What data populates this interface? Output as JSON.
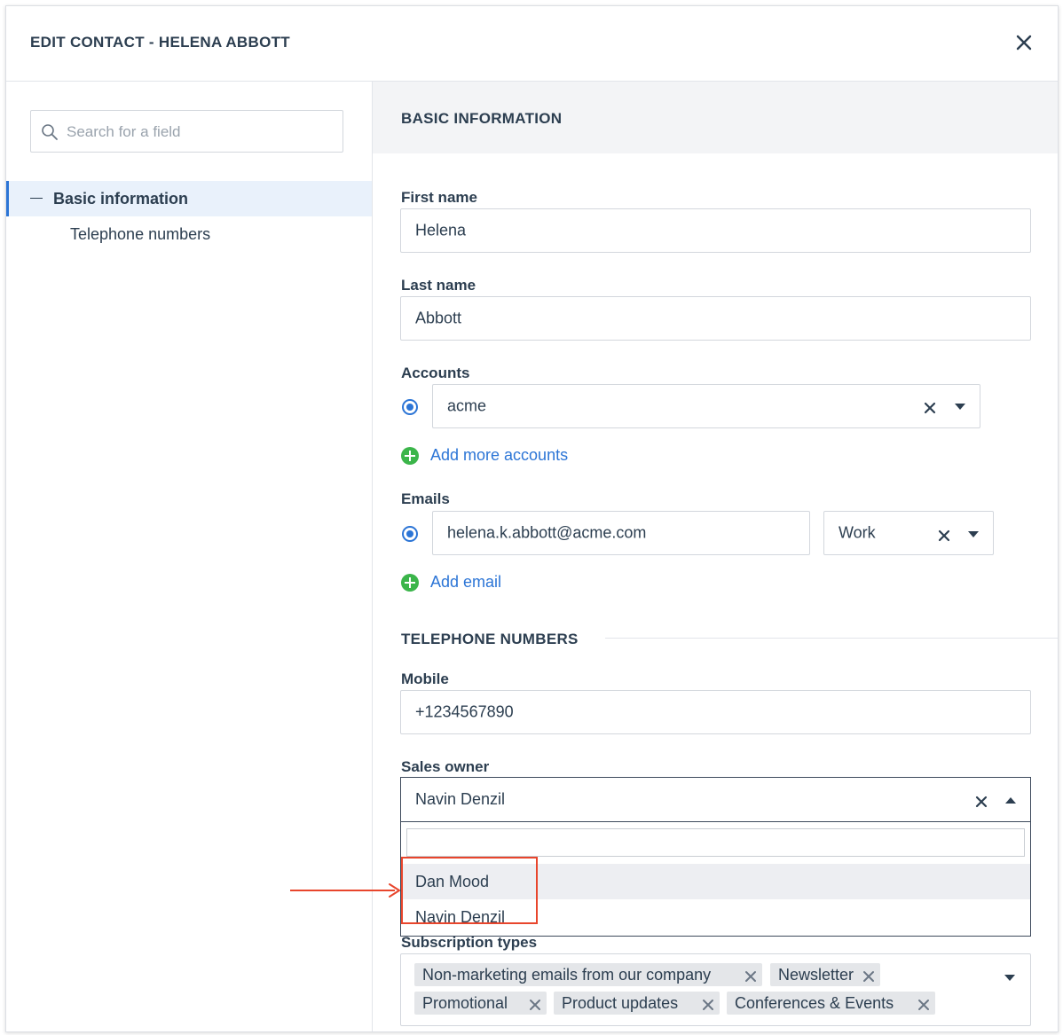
{
  "modal": {
    "title": "EDIT CONTACT - HELENA ABBOTT"
  },
  "sidebar": {
    "search_placeholder": "Search for a field",
    "items": [
      {
        "label": "Basic information",
        "active": true
      },
      {
        "label": "Telephone numbers",
        "active": false
      }
    ]
  },
  "main": {
    "section_title": "BASIC INFORMATION",
    "first_name": {
      "label": "First name",
      "value": "Helena"
    },
    "last_name": {
      "label": "Last name",
      "value": "Abbott"
    },
    "accounts": {
      "label": "Accounts",
      "value": "acme",
      "add_label": "Add more accounts"
    },
    "emails": {
      "label": "Emails",
      "value": "helena.k.abbott@acme.com",
      "type": "Work",
      "add_label": "Add email"
    },
    "telephone_section_title": "TELEPHONE NUMBERS",
    "mobile": {
      "label": "Mobile",
      "value": "+1234567890"
    },
    "sales_owner": {
      "label": "Sales owner",
      "value": "Navin Denzil",
      "search_value": "",
      "options": [
        "Dan Mood",
        "Navin Denzil"
      ]
    },
    "subscription_types": {
      "label": "Subscription types",
      "tags": [
        "Non-marketing emails from our company",
        "Newsletter",
        "Promotional",
        "Product updates",
        "Conferences & Events"
      ]
    }
  },
  "colors": {
    "accent": "#2c75d6",
    "add_green": "#3bb54a",
    "annotation_red": "#e8452c"
  }
}
